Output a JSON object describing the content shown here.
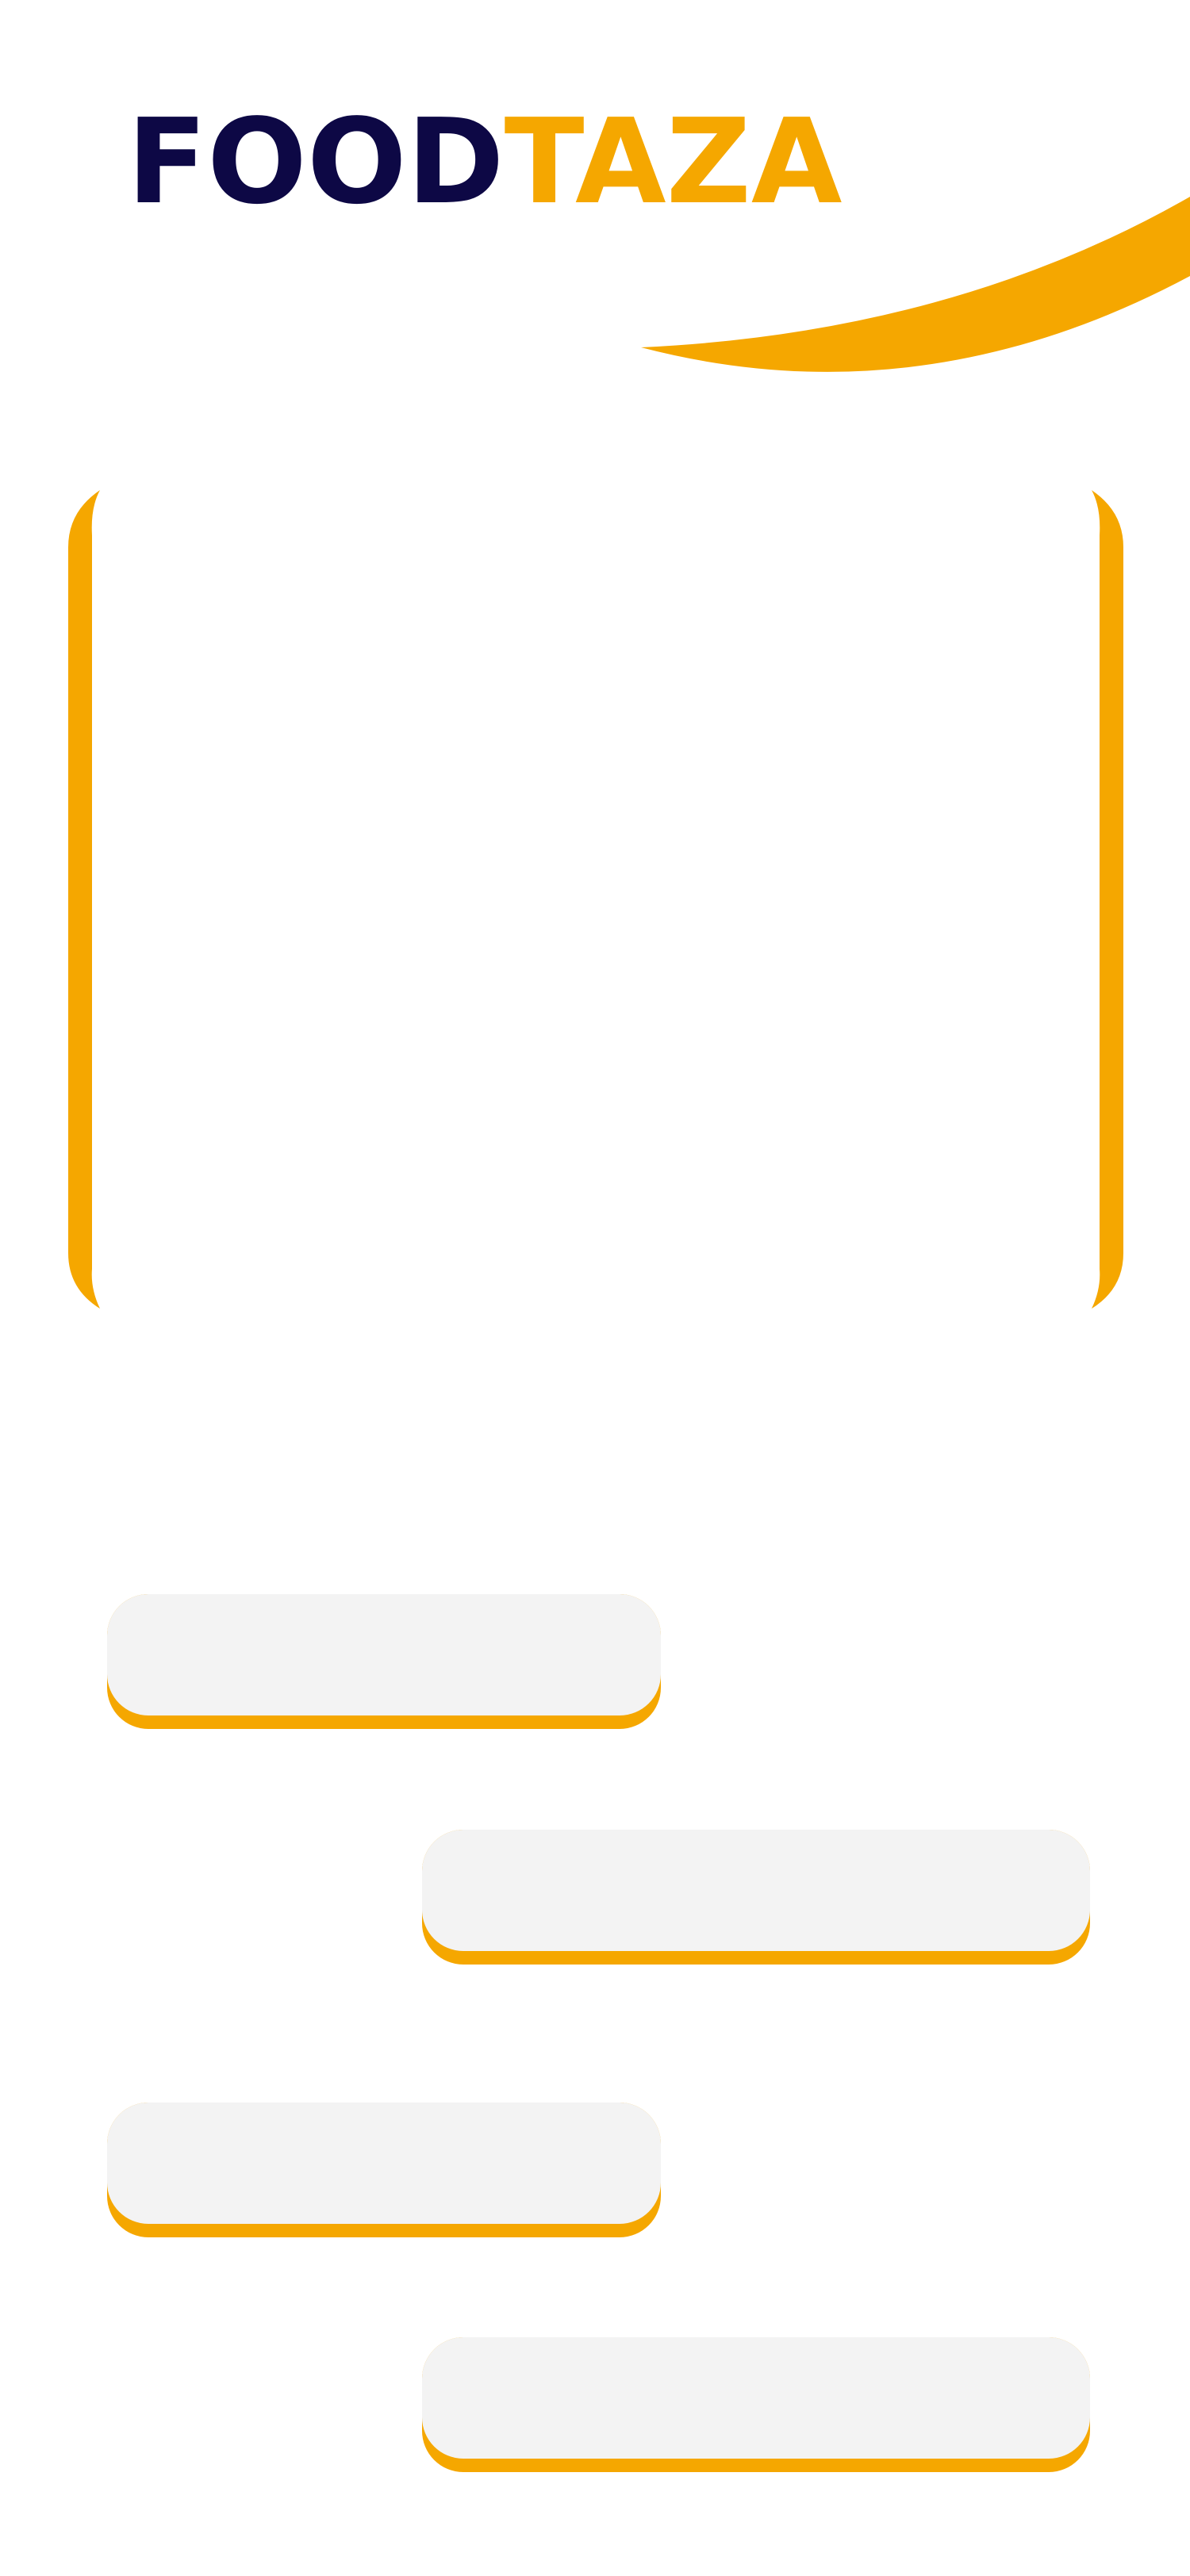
{
  "app": {
    "logo_part1": "FOOD",
    "logo_part2": "TAZA"
  },
  "colors": {
    "brand_dark": "#0d0845",
    "brand_accent": "#f5a700",
    "bubble_fill": "#f3f3f3",
    "background": "#ffffff"
  },
  "decor": {
    "swoosh": "orange-swoosh-shape",
    "frame": "orange-bracket-frame"
  },
  "options": [
    {
      "label": ""
    },
    {
      "label": ""
    },
    {
      "label": ""
    },
    {
      "label": ""
    }
  ]
}
